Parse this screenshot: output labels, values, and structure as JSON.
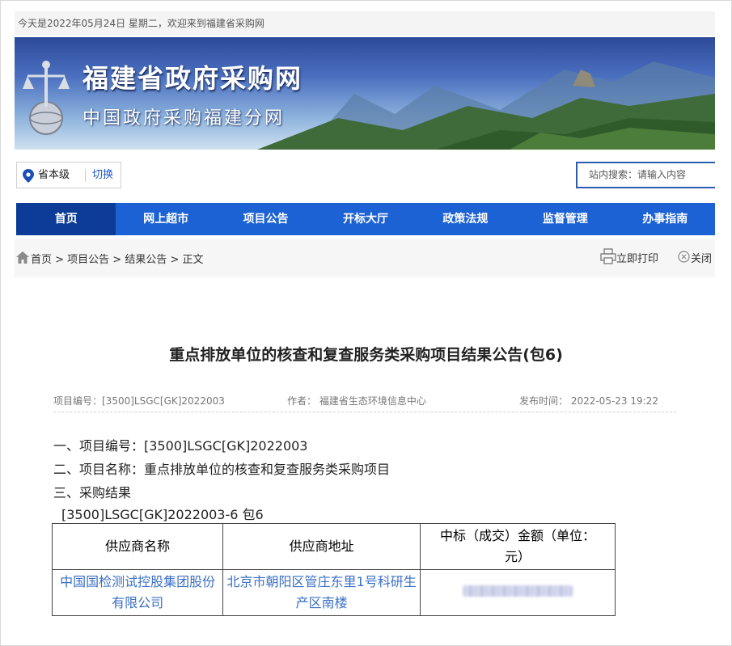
{
  "top_bar": {
    "text": "今天是2022年05月24日 星期二，欢迎来到福建省采购网"
  },
  "banner": {
    "title": "福建省政府采购网",
    "subtitle": "中国政府采购福建分网"
  },
  "location": {
    "level": "省本级",
    "switch": "切换"
  },
  "search": {
    "placeholder": "站内搜索：请输入内容"
  },
  "nav": {
    "items": [
      {
        "label": "首页",
        "active": true
      },
      {
        "label": "网上超市"
      },
      {
        "label": "项目公告"
      },
      {
        "label": "开标大厅"
      },
      {
        "label": "政策法规"
      },
      {
        "label": "监督管理"
      },
      {
        "label": "办事指南"
      }
    ]
  },
  "breadcrumb": {
    "text": "首页 > 项目公告 > 结果公告 > 正文"
  },
  "actions": {
    "print": "立即打印",
    "close": "关闭"
  },
  "article": {
    "title": "重点排放单位的核查和复查服务类采购项目结果公告(包6)",
    "project_no_meta": "项目编号：[3500]LSGC[GK]2022003",
    "author_meta": "作者：  福建省生态环境信息中心",
    "date_meta": "发布时间：  2022-05-23 19:22",
    "line1": "一、项目编号：[3500]LSGC[GK]2022003",
    "line2": "二、项目名称：重点排放单位的核查和复查服务类采购项目",
    "line3": "三、采购结果",
    "line4": "[3500]LSGC[GK]2022003-6 包6"
  },
  "result_table": {
    "headers": [
      "供应商名称",
      "供应商地址",
      "中标（成交）金额（单位：元）"
    ],
    "rows": [
      {
        "name": "中国国检测试控股集团股份有限公司",
        "address": "北京市朝阳区管庄东里1号科研生产区南楼",
        "amount": ""
      }
    ]
  },
  "colors": {
    "nav_bg": "#1c62d4",
    "nav_active": "#0c3c97",
    "link": "#3a6fc4",
    "switch": "#1c55c8"
  },
  "icons": {
    "pin": "location-pin-icon",
    "home": "home-icon",
    "print": "printer-icon",
    "close": "close-circle-icon"
  }
}
